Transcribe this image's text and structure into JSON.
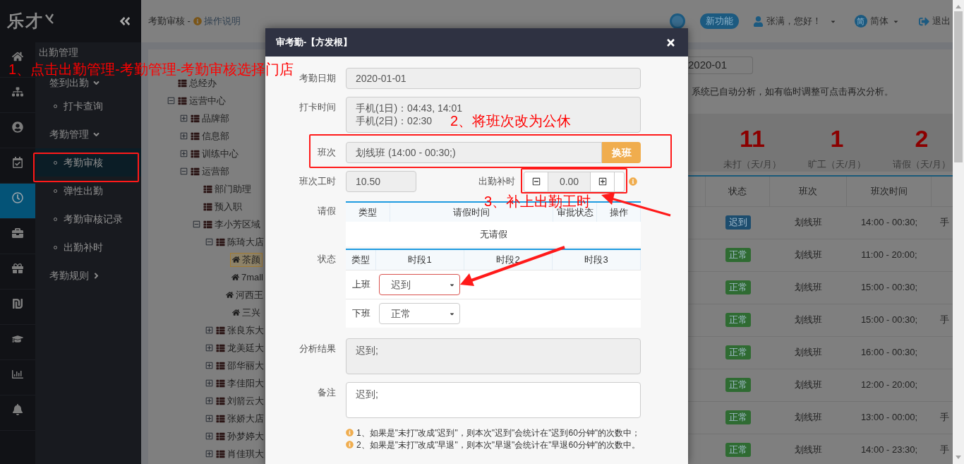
{
  "logo": {
    "text": "乐才"
  },
  "icon_rail": [
    {
      "kind": "home",
      "selected": false
    },
    {
      "kind": "sitemap",
      "selected": false
    },
    {
      "kind": "user",
      "selected": false
    },
    {
      "kind": "calendar",
      "selected": false
    },
    {
      "kind": "clock",
      "selected": true
    },
    {
      "kind": "briefcase",
      "selected": false
    },
    {
      "kind": "gift",
      "selected": false
    },
    {
      "kind": "shekel",
      "selected": false
    },
    {
      "kind": "graduation",
      "selected": false
    },
    {
      "kind": "chart",
      "selected": false
    },
    {
      "kind": "bell",
      "selected": false
    }
  ],
  "sidebar": {
    "title": "出勤管理",
    "items": [
      {
        "label": "签到出勤",
        "expanded": true,
        "children": [
          {
            "label": "打卡查询",
            "selected": false
          }
        ]
      },
      {
        "label": "考勤管理",
        "expanded": true,
        "children": [
          {
            "label": "考勤审核",
            "selected": true
          },
          {
            "label": "弹性出勤",
            "selected": false
          },
          {
            "label": "考勤审核记录",
            "selected": false
          },
          {
            "label": "出勤补时",
            "selected": false
          }
        ]
      },
      {
        "label": "考勤规则",
        "expanded": false
      }
    ]
  },
  "header": {
    "page_title": "考勤审核 -",
    "help_link": "操作说明",
    "new_feature": "新功能",
    "user": "张满，您好！",
    "language_badge": "简",
    "language": "简体",
    "logout": "退出"
  },
  "org_tree": [
    {
      "kind": "department",
      "label": "总经办"
    },
    {
      "kind": "group",
      "label": "运营中心",
      "expanded": true,
      "children": [
        {
          "kind": "group",
          "label": "品牌部",
          "expanded": false
        },
        {
          "kind": "group",
          "label": "信息部",
          "expanded": false
        },
        {
          "kind": "group",
          "label": "训练中心",
          "expanded": false
        },
        {
          "kind": "group",
          "label": "运营部",
          "expanded": true,
          "children": [
            {
              "kind": "department",
              "label": "部门助理"
            },
            {
              "kind": "department",
              "label": "预入职"
            },
            {
              "kind": "group",
              "label": "李小芳区域",
              "expanded": true,
              "children": [
                {
                  "kind": "group",
                  "label": "陈琦大店",
                  "expanded": true,
                  "children": [
                    {
                      "kind": "store",
                      "label": "茶颜",
                      "selected": true
                    },
                    {
                      "kind": "store",
                      "label": "7mall",
                      "selected": false
                    },
                    {
                      "kind": "store",
                      "label": "河西王",
                      "selected": false
                    },
                    {
                      "kind": "store",
                      "label": "三兴",
                      "selected": false
                    }
                  ]
                },
                {
                  "kind": "group",
                  "label": "张良东大",
                  "expanded": false
                },
                {
                  "kind": "group",
                  "label": "龙美廷大",
                  "expanded": false
                },
                {
                  "kind": "group",
                  "label": "邵华丽大",
                  "expanded": false
                },
                {
                  "kind": "group",
                  "label": "李佳阳大",
                  "expanded": false
                },
                {
                  "kind": "group",
                  "label": "刘箭云大",
                  "expanded": false
                },
                {
                  "kind": "group",
                  "label": "张娇大店",
                  "expanded": false
                },
                {
                  "kind": "group",
                  "label": "孙梦婷大",
                  "expanded": false
                },
                {
                  "kind": "group",
                  "label": "肖佳琪大",
                  "expanded": false
                }
              ]
            }
          ]
        }
      ]
    }
  ],
  "filter": {
    "month": "2020-01",
    "notice": "系统已自动分析，如有临时调整可点击再次分析。"
  },
  "stats": [
    {
      "value": "11",
      "label": "未打（天/月）"
    },
    {
      "value": "1",
      "label": "旷工（天/月）"
    },
    {
      "value": "2",
      "label": "请假（天/月）"
    }
  ],
  "table": {
    "columns": [
      "状态",
      "班次",
      "班次时间"
    ],
    "rows": [
      {
        "status": "迟到",
        "color": "#1d4d6e",
        "shift": "划线班",
        "time": "14:00 - 00:30;",
        "column_4": "手"
      },
      {
        "status": "正常",
        "color": "#2f6b32",
        "shift": "划线班",
        "time": "11:00 - 20:00;"
      },
      {
        "status": "正常",
        "color": "#2f6b32",
        "shift": "划线班",
        "time": "15:00 - 00:30;"
      },
      {
        "status": "正常",
        "color": "#2f6b32",
        "shift": "划线班",
        "time": "15:00 - 00:30;",
        "column_4": "手"
      },
      {
        "status": "正常",
        "color": "#2f6b32",
        "shift": "划线班",
        "time": "16:00 - 00:30;"
      },
      {
        "status": "正常",
        "color": "#2f6b32",
        "shift": "划线班",
        "time": "12:00 - 20:00;"
      },
      {
        "status": "正常",
        "color": "#2f6b32",
        "shift": "划线班",
        "time": "13:00 - 00:00;",
        "column_4": "手"
      },
      {
        "status": "正常",
        "color": "#2f6b32",
        "shift": "划线班",
        "time": "14:00 - 23:30;",
        "column_4": "手"
      }
    ]
  },
  "dialog": {
    "title": "审考勤-【方发根】",
    "date": {
      "label": "考勤日期",
      "value": "2020-01-01"
    },
    "punches": {
      "label": "打卡时间",
      "lines": [
        "手机(1日)：04:43, 14:01",
        "手机(2日)：02:30"
      ]
    },
    "shift": {
      "label": "班次",
      "value": "划线班 (14:00 - 00:30;)",
      "button": "换班"
    },
    "shift_hours": {
      "label": "班次工时",
      "value": "10.50"
    },
    "extra_hours": {
      "label": "出勤补时",
      "value": "0.00"
    },
    "leave": {
      "label": "请假",
      "columns": [
        "类型",
        "请假时间",
        "审批状态",
        "操作"
      ],
      "empty": "无请假"
    },
    "status": {
      "label": "状态",
      "columns": [
        "类型",
        "时段1",
        "时段2",
        "时段3"
      ],
      "rows": [
        {
          "type": "上班",
          "value": "迟到",
          "flagged": true
        },
        {
          "type": "下班",
          "value": "正常",
          "flagged": false
        }
      ]
    },
    "analysis": {
      "label": "分析结果",
      "value": "迟到;"
    },
    "remark": {
      "label": "备注",
      "value": "迟到;"
    },
    "notes": [
      "1、如果是\"未打\"改成\"迟到\"，则本次\"迟到\"会统计在\"迟到60分钟\"的次数中；",
      "2、如果是\"未打\"改成\"早退\"，则本次\"早退\"会统计在\"早退60分钟\"的次数中。"
    ]
  },
  "annotations": [
    "1、点击出勤管理-考勤管理-考勤审核选择门店",
    "2、将班次改为公休",
    "3、补上出勤工时"
  ]
}
